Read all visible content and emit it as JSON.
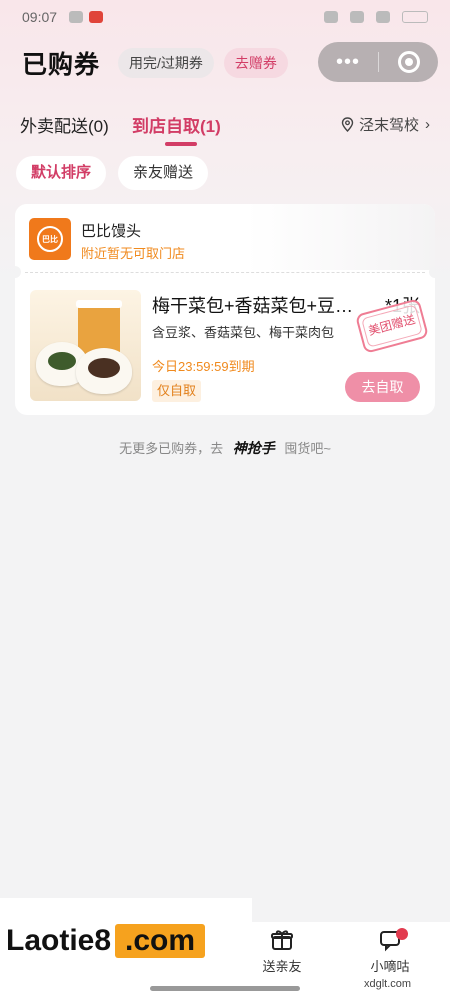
{
  "status_bar": {
    "time": "09:07"
  },
  "header": {
    "title": "已购券",
    "expired_label": "用完/过期券",
    "gift_label": "去赠券"
  },
  "tabs": [
    {
      "label": "外卖配送(0)"
    },
    {
      "label": "到店自取(1)"
    }
  ],
  "location": {
    "label": "泾末驾校"
  },
  "sort": {
    "default_label": "默认排序",
    "gift_label": "亲友赠送"
  },
  "voucher": {
    "shop_name": "巴比馒头",
    "shop_note": "附近暂无可取门店",
    "product_name": "梅干菜包+香菇菜包+豆…",
    "quantity": "*1张",
    "description": "含豆浆、香菇菜包、梅干菜肉包",
    "stamp": "美团赠送",
    "expire": "今日23:59:59到期",
    "tag": "仅自取",
    "action_label": "去自取",
    "logo_text": "巴比"
  },
  "footer_note": {
    "prefix": "无更多已购券，去",
    "brand": "神抢手",
    "suffix": "囤货吧~"
  },
  "bottom_nav": [
    {
      "label": "送亲友",
      "icon": "gift-icon"
    },
    {
      "label": "小嘀咕",
      "icon": "chat-icon"
    }
  ],
  "watermark": {
    "main": "Laotie8",
    "suffix": ".com",
    "small": "xdglt.com"
  },
  "colors": {
    "accent": "#d23d66",
    "orange": "#f08a1e",
    "button": "#ef8fa7"
  }
}
